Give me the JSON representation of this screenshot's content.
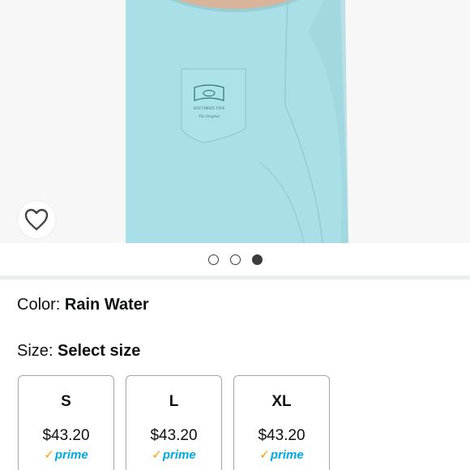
{
  "product": {
    "image_gallery": {
      "dot_count": 3,
      "active_dot": 3
    },
    "color": {
      "label": "Color:",
      "value": "Rain Water"
    },
    "size": {
      "label": "Size:",
      "value": "Select size"
    },
    "sizes": [
      {
        "name": "S",
        "price": "$43.20",
        "badge": "prime"
      },
      {
        "name": "L",
        "price": "$43.20",
        "badge": "prime"
      },
      {
        "name": "XL",
        "price": "$43.20",
        "badge": "prime"
      }
    ],
    "shirt_print": {
      "brand": "SOUTHERN TIDE",
      "script": "The Original"
    }
  },
  "colors": {
    "shirt": "#a9dfe6",
    "prime_blue": "#00a8e1",
    "prime_check": "#f7a100",
    "dot_dark": "#3c3c3c"
  },
  "icons": {
    "wishlist": "heart-outline-icon",
    "prime": "prime-check-icon"
  }
}
